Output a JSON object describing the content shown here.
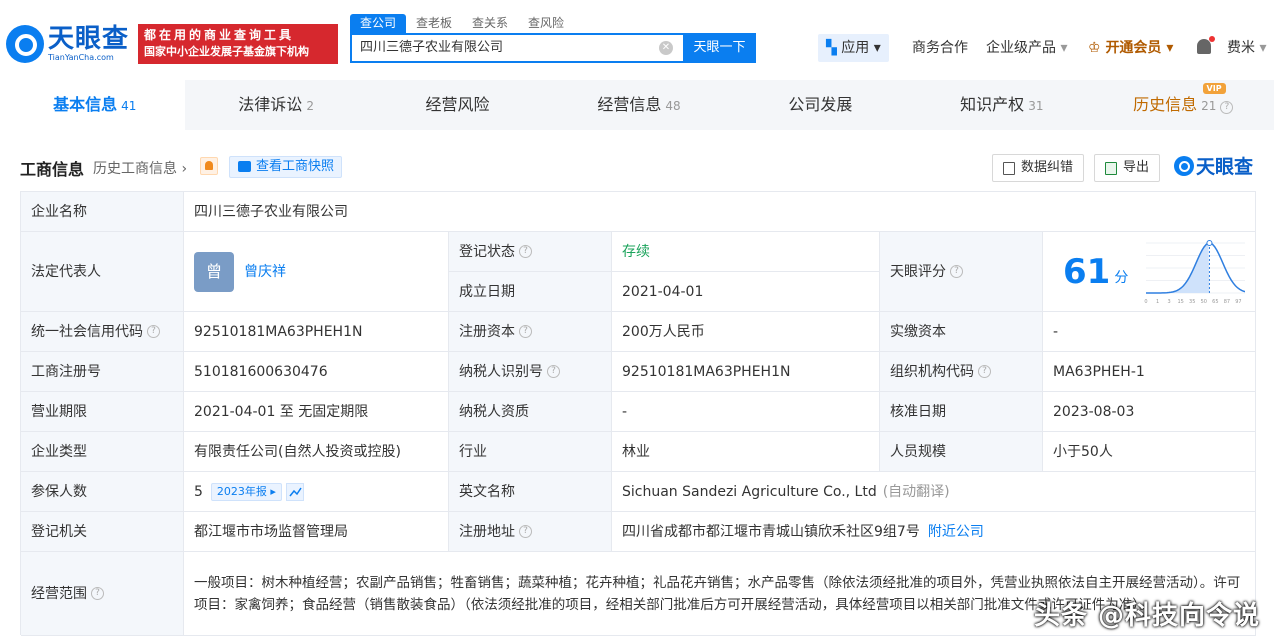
{
  "header": {
    "logo_cn": "天眼查",
    "logo_en": "TianYanCha.com",
    "slogan_1": "都在用的商业查询工具",
    "slogan_2": "国家中小企业发展子基金旗下机构",
    "search_tabs": [
      "查公司",
      "查老板",
      "查关系",
      "查风险"
    ],
    "search_value": "四川三德子农业有限公司",
    "search_button": "天眼一下",
    "nav_app": "应用",
    "nav_business": "商务合作",
    "nav_enterprise": "企业级产品",
    "nav_vip": "开通会员",
    "nav_user": "费米"
  },
  "tabs": [
    {
      "label": "基本信息",
      "count": "41"
    },
    {
      "label": "法律诉讼",
      "count": "2"
    },
    {
      "label": "经营风险",
      "count": ""
    },
    {
      "label": "经营信息",
      "count": "48"
    },
    {
      "label": "公司发展",
      "count": ""
    },
    {
      "label": "知识产权",
      "count": "31"
    },
    {
      "label": "历史信息",
      "count": "21"
    }
  ],
  "vip_badge": "VIP",
  "section": {
    "title": "工商信息",
    "history_link": "历史工商信息",
    "snapshot_button": "查看工商快照",
    "correct_button": "数据纠错",
    "export_button": "导出",
    "brand": "天眼查"
  },
  "info": {
    "name_label": "企业名称",
    "name_value": "四川三德子农业有限公司",
    "legal_label": "法定代表人",
    "legal_avatar": "曾",
    "legal_value": "曾庆祥",
    "status_label": "登记状态",
    "status_value": "存续",
    "found_label": "成立日期",
    "found_value": "2021-04-01",
    "score_label": "天眼评分",
    "score_value": "61",
    "score_unit": "分",
    "credit_label": "统一社会信用代码",
    "credit_value": "92510181MA63PHEH1N",
    "capital_label": "注册资本",
    "capital_value": "200万人民币",
    "paid_label": "实缴资本",
    "paid_value": "-",
    "reg_label": "工商注册号",
    "reg_value": "510181600630476",
    "taxid_label": "纳税人识别号",
    "taxid_value": "92510181MA63PHEH1N",
    "org_label": "组织机构代码",
    "org_value": "MA63PHEH-1",
    "term_label": "营业期限",
    "term_value": "2021-04-01 至 无固定期限",
    "taxq_label": "纳税人资质",
    "taxq_value": "-",
    "approve_label": "核准日期",
    "approve_value": "2023-08-03",
    "type_label": "企业类型",
    "type_value": "有限责任公司(自然人投资或控股)",
    "industry_label": "行业",
    "industry_value": "林业",
    "staff_label": "人员规模",
    "staff_value": "小于50人",
    "insured_label": "参保人数",
    "insured_value": "5",
    "insured_badge": "2023年报",
    "en_label": "英文名称",
    "en_value": "Sichuan Sandezi Agriculture Co., Ltd",
    "en_note": "(自动翻译)",
    "authority_label": "登记机关",
    "authority_value": "都江堰市市场监督管理局",
    "addr_label": "注册地址",
    "addr_value": "四川省成都市都江堰市青城山镇欣禾社区9组7号",
    "addr_link": "附近公司",
    "scope_label": "经营范围",
    "scope_value": "一般项目：树木种植经营；农副产品销售；牲畜销售；蔬菜种植；花卉种植；礼品花卉销售；水产品零售（除依法须经批准的项目外，凭营业执照依法自主开展经营活动）。许可项目：家禽饲养；食品经营（销售散装食品）（依法须经批准的项目，经相关部门批准后方可开展经营活动，具体经营项目以相关部门批准文件或许可证件为准）。"
  },
  "score_chart": {
    "ticks": [
      "0",
      "1",
      "3",
      "15",
      "35",
      "50",
      "65",
      "87",
      "97",
      "100"
    ],
    "colors": {
      "line": "#2f7fe0",
      "fill": "#cfe2fb"
    }
  },
  "watermark": "头条 @科技向令说"
}
